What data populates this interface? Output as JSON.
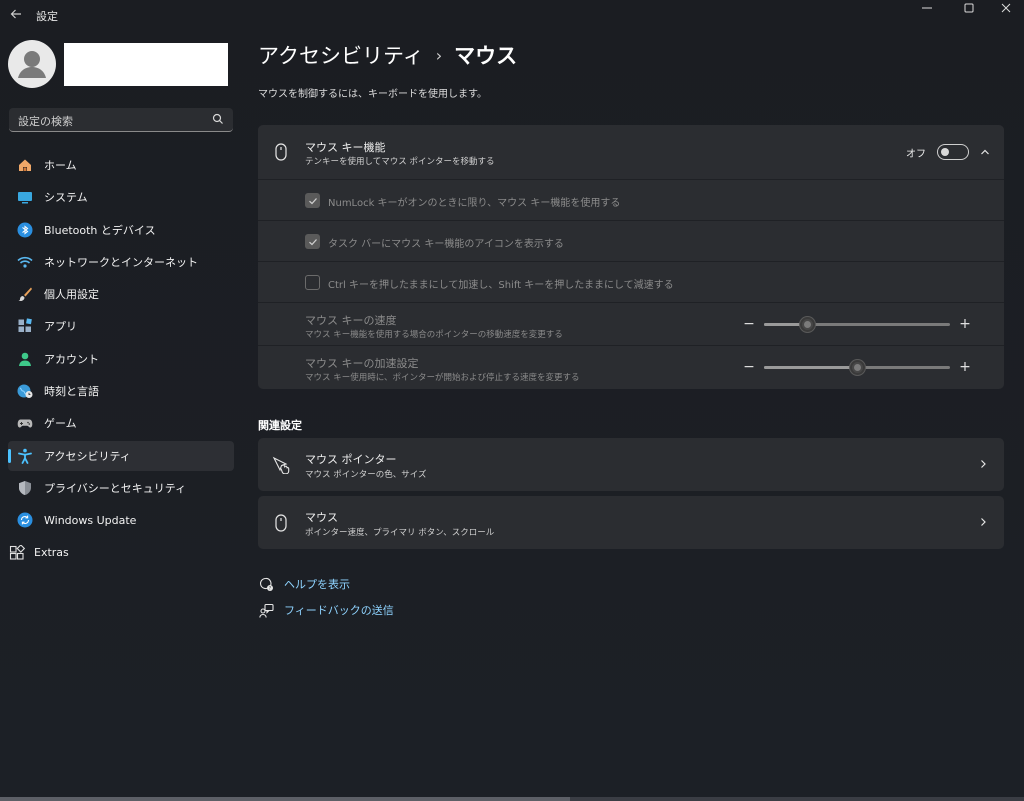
{
  "app": {
    "title": "設定"
  },
  "search": {
    "placeholder": "設定の検索"
  },
  "sidebar": {
    "items": [
      {
        "label": "ホーム",
        "icon": "home-icon"
      },
      {
        "label": "システム",
        "icon": "system-icon"
      },
      {
        "label": "Bluetooth とデバイス",
        "icon": "bluetooth-icon"
      },
      {
        "label": "ネットワークとインターネット",
        "icon": "network-icon"
      },
      {
        "label": "個人用設定",
        "icon": "brush-icon"
      },
      {
        "label": "アプリ",
        "icon": "apps-icon"
      },
      {
        "label": "アカウント",
        "icon": "account-icon"
      },
      {
        "label": "時刻と言語",
        "icon": "globe-clock-icon"
      },
      {
        "label": "ゲーム",
        "icon": "gamepad-icon"
      },
      {
        "label": "アクセシビリティ",
        "icon": "accessibility-icon",
        "active": true
      },
      {
        "label": "プライバシーとセキュリティ",
        "icon": "shield-icon"
      },
      {
        "label": "Windows Update",
        "icon": "update-icon"
      },
      {
        "label": "Extras",
        "icon": "extras-icon"
      }
    ]
  },
  "main": {
    "breadcrumb_parent": "アクセシビリティ",
    "breadcrumb_separator": "›",
    "breadcrumb_current": "マウス",
    "subtitle": "マウスを制御するには、キーボードを使用します。",
    "mouse_keys": {
      "title": "マウス キー機能",
      "desc": "テンキーを使用してマウス ポインターを移動する",
      "toggle_label": "オフ",
      "toggle_on": false,
      "options": [
        {
          "label": "NumLock キーがオンのときに限り、マウス キー機能を使用する",
          "checked": true
        },
        {
          "label": "タスク バーにマウス キー機能のアイコンを表示する",
          "checked": true
        },
        {
          "label": "Ctrl キーを押したままにして加速し、Shift キーを押したままにして減速する",
          "checked": false
        }
      ],
      "speed": {
        "title": "マウス キーの速度",
        "desc": "マウス キー機能を使用する場合のポインターの移動速度を変更する",
        "value": 0.23
      },
      "accel": {
        "title": "マウス キーの加速設定",
        "desc": "マウス キー使用時に、ポインターが開始および停止する速度を変更する",
        "value": 0.5
      },
      "minus": "−",
      "plus": "+"
    },
    "related": {
      "title": "関連設定",
      "items": [
        {
          "title": "マウス ポインター",
          "desc": "マウス ポインターの色、サイズ",
          "icon": "mouse-pointer-icon"
        },
        {
          "title": "マウス",
          "desc": "ポインター速度、プライマリ ボタン、スクロール",
          "icon": "mouse-icon"
        }
      ]
    },
    "help": {
      "label": "ヘルプを表示",
      "icon": "help-icon"
    },
    "feedback": {
      "label": "フィードバックの送信",
      "icon": "feedback-icon"
    }
  },
  "colors": {
    "accent": "#4cc2ff",
    "card": "#2b2d31",
    "background": "#1c1f24"
  }
}
